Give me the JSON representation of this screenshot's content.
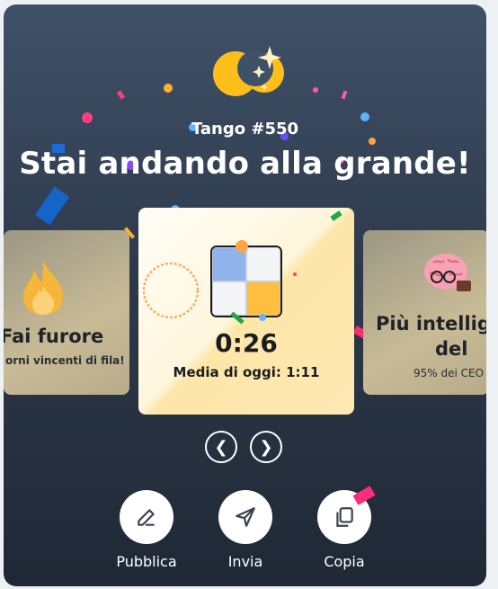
{
  "puzzle": {
    "title": "Tango #550"
  },
  "headline": "Stai andando alla grande!",
  "cards": {
    "left": {
      "title": "Fai furore",
      "subtitle": "orni vincenti di fila!",
      "icon": "flame-icon"
    },
    "center": {
      "time": "0:26",
      "average": "Media di oggi: 1:11",
      "board_colors": [
        "#8fb4ec",
        "#f4f5f7",
        "#f4f5f7",
        "#ffbe3d"
      ],
      "icon": "timer-ring-icon"
    },
    "right": {
      "title": "Più intellige",
      "title_line2": "del",
      "subtitle": "95% dei CEO",
      "icon": "brain-icon"
    }
  },
  "carousel": {
    "prev": "❮",
    "next": "❯"
  },
  "actions": [
    {
      "label": "Pubblica",
      "icon": "edit-icon"
    },
    {
      "label": "Invia",
      "icon": "send-icon"
    },
    {
      "label": "Copia",
      "icon": "copy-icon"
    }
  ],
  "colors": {
    "background_top": "#3f5168",
    "background_bottom": "#1f2835",
    "sun": "#ffbe1a",
    "board_blue": "#8fb4ec",
    "board_yellow": "#ffbe3d"
  }
}
